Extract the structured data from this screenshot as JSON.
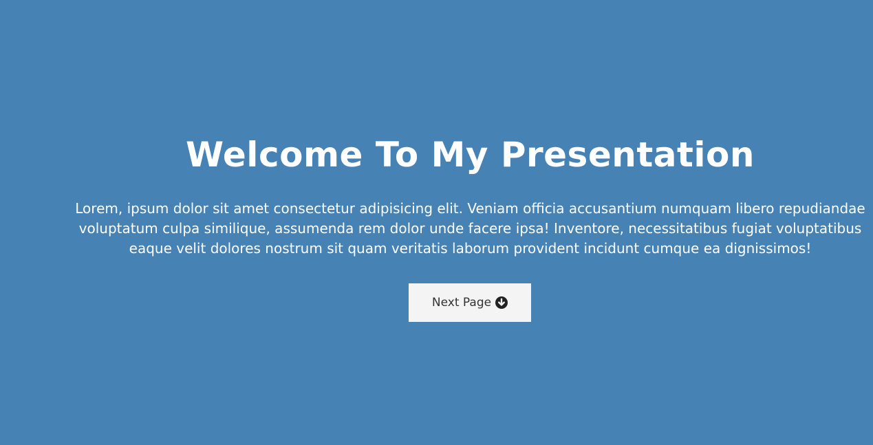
{
  "hero": {
    "title": "Welcome To My Presentation",
    "subtitle_lines": [
      "Lorem, ipsum dolor sit amet consectetur adipisicing elit. Veniam officia accusantium numquam libero repudiandae",
      "voluptatum culpa similique, assumenda rem dolor unde facere ipsa! Inventore, necessitatibus fugiat voluptatibus",
      "eaque velit dolores nostrum sit quam veritatis laborum provident incidunt cumque ea dignissimos!"
    ],
    "button": {
      "label": "Next Page",
      "icon": "arrow-circle-down-icon"
    }
  },
  "colors": {
    "background": "#4682b4",
    "text": "#ffffff",
    "button_bg": "#f4f4f4",
    "button_text": "#333333"
  }
}
